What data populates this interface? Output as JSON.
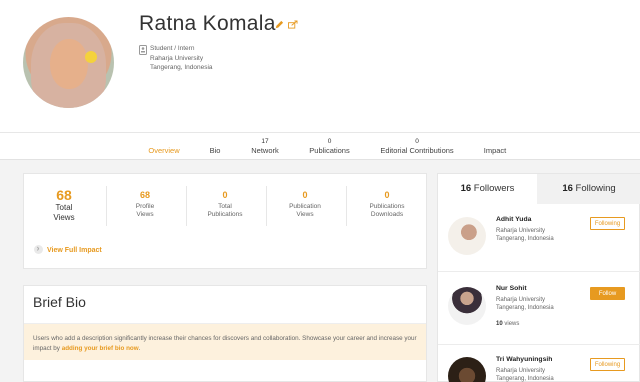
{
  "profile": {
    "name": "Ratna Komala",
    "role": "Student / Intern",
    "institution": "Raharja University",
    "location": "Tangerang, Indonesia"
  },
  "tabs": [
    {
      "count": "",
      "label": "Overview",
      "active": true
    },
    {
      "count": "",
      "label": "Bio"
    },
    {
      "count": "17",
      "label": "Network"
    },
    {
      "count": "0",
      "label": "Publications"
    },
    {
      "count": "0",
      "label": "Editorial Contributions"
    },
    {
      "count": "",
      "label": "Impact"
    }
  ],
  "stats": {
    "total_views": {
      "value": "68",
      "label_line1": "Total",
      "label_line2": "Views"
    },
    "profile_views": {
      "value": "68",
      "label_line1": "Profile",
      "label_line2": "Views"
    },
    "total_publications": {
      "value": "0",
      "label_line1": "Total",
      "label_line2": "Publications"
    },
    "publication_views": {
      "value": "0",
      "label_line1": "Publication",
      "label_line2": "Views"
    },
    "publications_downloads": {
      "value": "0",
      "label_line1": "Publications",
      "label_line2": "Downloads"
    },
    "full_impact_link": "View Full Impact"
  },
  "bio": {
    "title": "Brief Bio",
    "note_text": "Users who add a description significantly increase their chances for discovers and collaboration. Showcase your career and increase your impact by",
    "note_link": "adding your brief bio now",
    "note_end": "."
  },
  "follow": {
    "followers_count": "16",
    "followers_label": "Followers",
    "following_count": "16",
    "following_label": "Following",
    "people": [
      {
        "name": "Adhit Yuda",
        "institution": "Raharja University",
        "location": "Tangerang, Indonesia",
        "views": "",
        "button": "Following"
      },
      {
        "name": "Nur Sohit",
        "institution": "Raharja University",
        "location": "Tangerang, Indonesia",
        "views": "10",
        "views_label": "views",
        "button": "Follow"
      },
      {
        "name": "Tri Wahyuningsih",
        "institution": "Raharja University",
        "location": "Tangerang, Indonesia",
        "views": "",
        "button": "Following"
      }
    ]
  },
  "colors": {
    "accent": "#e79a20",
    "note_bg": "#fdf1dd",
    "page_bg": "#f3f3f3"
  },
  "icons": [
    "pencil-icon",
    "share-icon",
    "id-badge-icon",
    "chevron-right-icon"
  ]
}
